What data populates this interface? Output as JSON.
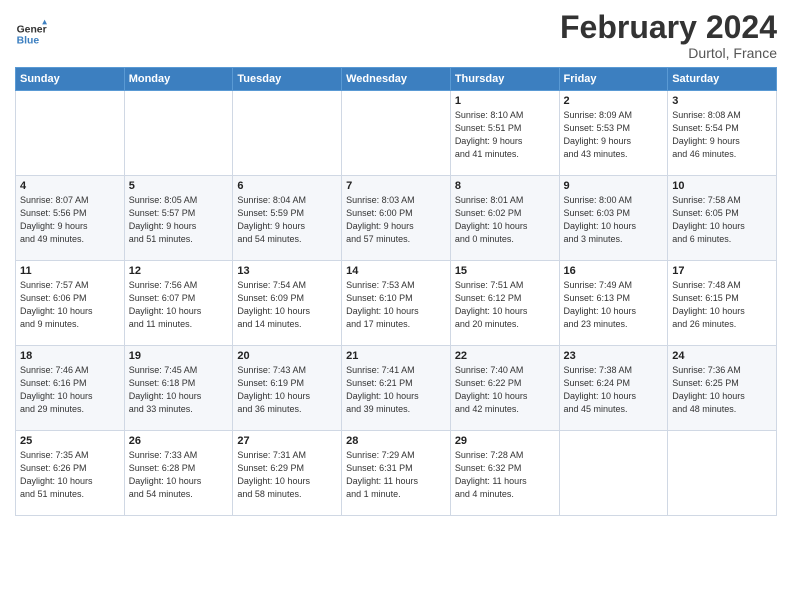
{
  "header": {
    "logo_general": "General",
    "logo_blue": "Blue",
    "month_title": "February 2024",
    "location": "Durtol, France"
  },
  "days_of_week": [
    "Sunday",
    "Monday",
    "Tuesday",
    "Wednesday",
    "Thursday",
    "Friday",
    "Saturday"
  ],
  "weeks": [
    [
      {
        "day": "",
        "info": ""
      },
      {
        "day": "",
        "info": ""
      },
      {
        "day": "",
        "info": ""
      },
      {
        "day": "",
        "info": ""
      },
      {
        "day": "1",
        "info": "Sunrise: 8:10 AM\nSunset: 5:51 PM\nDaylight: 9 hours\nand 41 minutes."
      },
      {
        "day": "2",
        "info": "Sunrise: 8:09 AM\nSunset: 5:53 PM\nDaylight: 9 hours\nand 43 minutes."
      },
      {
        "day": "3",
        "info": "Sunrise: 8:08 AM\nSunset: 5:54 PM\nDaylight: 9 hours\nand 46 minutes."
      }
    ],
    [
      {
        "day": "4",
        "info": "Sunrise: 8:07 AM\nSunset: 5:56 PM\nDaylight: 9 hours\nand 49 minutes."
      },
      {
        "day": "5",
        "info": "Sunrise: 8:05 AM\nSunset: 5:57 PM\nDaylight: 9 hours\nand 51 minutes."
      },
      {
        "day": "6",
        "info": "Sunrise: 8:04 AM\nSunset: 5:59 PM\nDaylight: 9 hours\nand 54 minutes."
      },
      {
        "day": "7",
        "info": "Sunrise: 8:03 AM\nSunset: 6:00 PM\nDaylight: 9 hours\nand 57 minutes."
      },
      {
        "day": "8",
        "info": "Sunrise: 8:01 AM\nSunset: 6:02 PM\nDaylight: 10 hours\nand 0 minutes."
      },
      {
        "day": "9",
        "info": "Sunrise: 8:00 AM\nSunset: 6:03 PM\nDaylight: 10 hours\nand 3 minutes."
      },
      {
        "day": "10",
        "info": "Sunrise: 7:58 AM\nSunset: 6:05 PM\nDaylight: 10 hours\nand 6 minutes."
      }
    ],
    [
      {
        "day": "11",
        "info": "Sunrise: 7:57 AM\nSunset: 6:06 PM\nDaylight: 10 hours\nand 9 minutes."
      },
      {
        "day": "12",
        "info": "Sunrise: 7:56 AM\nSunset: 6:07 PM\nDaylight: 10 hours\nand 11 minutes."
      },
      {
        "day": "13",
        "info": "Sunrise: 7:54 AM\nSunset: 6:09 PM\nDaylight: 10 hours\nand 14 minutes."
      },
      {
        "day": "14",
        "info": "Sunrise: 7:53 AM\nSunset: 6:10 PM\nDaylight: 10 hours\nand 17 minutes."
      },
      {
        "day": "15",
        "info": "Sunrise: 7:51 AM\nSunset: 6:12 PM\nDaylight: 10 hours\nand 20 minutes."
      },
      {
        "day": "16",
        "info": "Sunrise: 7:49 AM\nSunset: 6:13 PM\nDaylight: 10 hours\nand 23 minutes."
      },
      {
        "day": "17",
        "info": "Sunrise: 7:48 AM\nSunset: 6:15 PM\nDaylight: 10 hours\nand 26 minutes."
      }
    ],
    [
      {
        "day": "18",
        "info": "Sunrise: 7:46 AM\nSunset: 6:16 PM\nDaylight: 10 hours\nand 29 minutes."
      },
      {
        "day": "19",
        "info": "Sunrise: 7:45 AM\nSunset: 6:18 PM\nDaylight: 10 hours\nand 33 minutes."
      },
      {
        "day": "20",
        "info": "Sunrise: 7:43 AM\nSunset: 6:19 PM\nDaylight: 10 hours\nand 36 minutes."
      },
      {
        "day": "21",
        "info": "Sunrise: 7:41 AM\nSunset: 6:21 PM\nDaylight: 10 hours\nand 39 minutes."
      },
      {
        "day": "22",
        "info": "Sunrise: 7:40 AM\nSunset: 6:22 PM\nDaylight: 10 hours\nand 42 minutes."
      },
      {
        "day": "23",
        "info": "Sunrise: 7:38 AM\nSunset: 6:24 PM\nDaylight: 10 hours\nand 45 minutes."
      },
      {
        "day": "24",
        "info": "Sunrise: 7:36 AM\nSunset: 6:25 PM\nDaylight: 10 hours\nand 48 minutes."
      }
    ],
    [
      {
        "day": "25",
        "info": "Sunrise: 7:35 AM\nSunset: 6:26 PM\nDaylight: 10 hours\nand 51 minutes."
      },
      {
        "day": "26",
        "info": "Sunrise: 7:33 AM\nSunset: 6:28 PM\nDaylight: 10 hours\nand 54 minutes."
      },
      {
        "day": "27",
        "info": "Sunrise: 7:31 AM\nSunset: 6:29 PM\nDaylight: 10 hours\nand 58 minutes."
      },
      {
        "day": "28",
        "info": "Sunrise: 7:29 AM\nSunset: 6:31 PM\nDaylight: 11 hours\nand 1 minute."
      },
      {
        "day": "29",
        "info": "Sunrise: 7:28 AM\nSunset: 6:32 PM\nDaylight: 11 hours\nand 4 minutes."
      },
      {
        "day": "",
        "info": ""
      },
      {
        "day": "",
        "info": ""
      }
    ]
  ]
}
